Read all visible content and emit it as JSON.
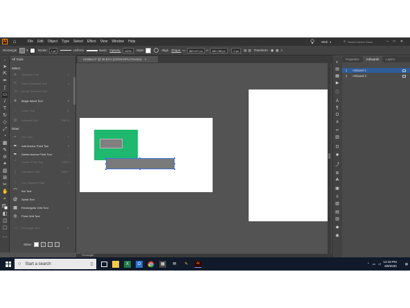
{
  "menubar": {
    "app_logo": "Ai",
    "menus": [
      "File",
      "Edit",
      "Object",
      "Type",
      "Select",
      "Effect",
      "View",
      "Window",
      "Help"
    ],
    "workspace": "Web",
    "search_placeholder": "Search Adobe Stock"
  },
  "controlbar": {
    "selection": "Rectangle",
    "stroke_label": "Stroke:",
    "stroke_value": "1 pt",
    "profile": "Uniform",
    "brush": "Basic",
    "opacity_label": "Opacity:",
    "opacity_value": "100%",
    "style_label": "Style:",
    "align_label": "Align",
    "shape_label": "Shape:",
    "w_value": "383.417 px",
    "h_value": "180.766 px",
    "corner_value": "0 px",
    "transform_label": "Transform"
  },
  "alltools": {
    "title": "All Tools",
    "sections": {
      "select": "Select:",
      "draw": "Draw:"
    },
    "select_tools": [
      {
        "label": "Selection Tool",
        "key": "V",
        "active": false
      },
      {
        "label": "Direct Selection Tool",
        "key": "A",
        "active": false
      },
      {
        "label": "Group Selection Tool",
        "key": "",
        "active": false
      },
      {
        "label": "Magic Wand Tool",
        "key": "Y",
        "active": true
      },
      {
        "label": "Lasso Tool",
        "key": "Q",
        "active": false
      },
      {
        "label": "Artboard Tool",
        "key": "Shift+O",
        "active": false
      }
    ],
    "draw_tools": [
      {
        "label": "Pen Tool",
        "key": "P",
        "active": false
      },
      {
        "label": "Add Anchor Point Tool",
        "key": "+",
        "active": true
      },
      {
        "label": "Delete Anchor Point Tool",
        "key": "-",
        "active": true
      },
      {
        "label": "Anchor Point Tool",
        "key": "Shift+C",
        "active": false
      },
      {
        "label": "Curvature Tool",
        "key": "Shift+~",
        "active": false
      },
      {
        "label": "Line Segment Tool",
        "key": "\\",
        "active": false
      },
      {
        "label": "Arc Tool",
        "key": "",
        "active": true
      },
      {
        "label": "Spiral Tool",
        "key": "",
        "active": true
      },
      {
        "label": "Rectangular Grid Tool",
        "key": "",
        "active": true
      },
      {
        "label": "Polar Grid Tool",
        "key": "",
        "active": true
      },
      {
        "label": "Rectangle Tool",
        "key": "M",
        "active": false
      }
    ],
    "show_label": "Show:"
  },
  "document": {
    "tab_title": "Untitled-2* @ 38.81% (CMYK/GPU Preview)",
    "close_glyph": "×"
  },
  "statusbar": {
    "tool_name": "Rectangle"
  },
  "panel": {
    "tabs": [
      "Properties",
      "Artboards",
      "Layers"
    ],
    "active_tab": "Artboards",
    "artboards": [
      {
        "num": "1",
        "name": "Artboard 1",
        "selected": true
      },
      {
        "num": "2",
        "name": "Artboard 2",
        "selected": false
      }
    ]
  },
  "taskbar": {
    "search_placeholder": "Start a search",
    "time": "12:18 PM",
    "date": "6/9/2020"
  },
  "colors": {
    "green_shape": "#1eb96e",
    "grey_shape": "#7a7a7a",
    "selection_blue": "#3f6fd6",
    "ui_dark": "#323232",
    "canvas_bg": "#535353",
    "taskbar": "#101a2b"
  },
  "icons": {
    "home": "⌂",
    "search": "⌕",
    "mic": "🎙",
    "lightbulb": "💡",
    "close": "×",
    "chevron": "⌄"
  }
}
